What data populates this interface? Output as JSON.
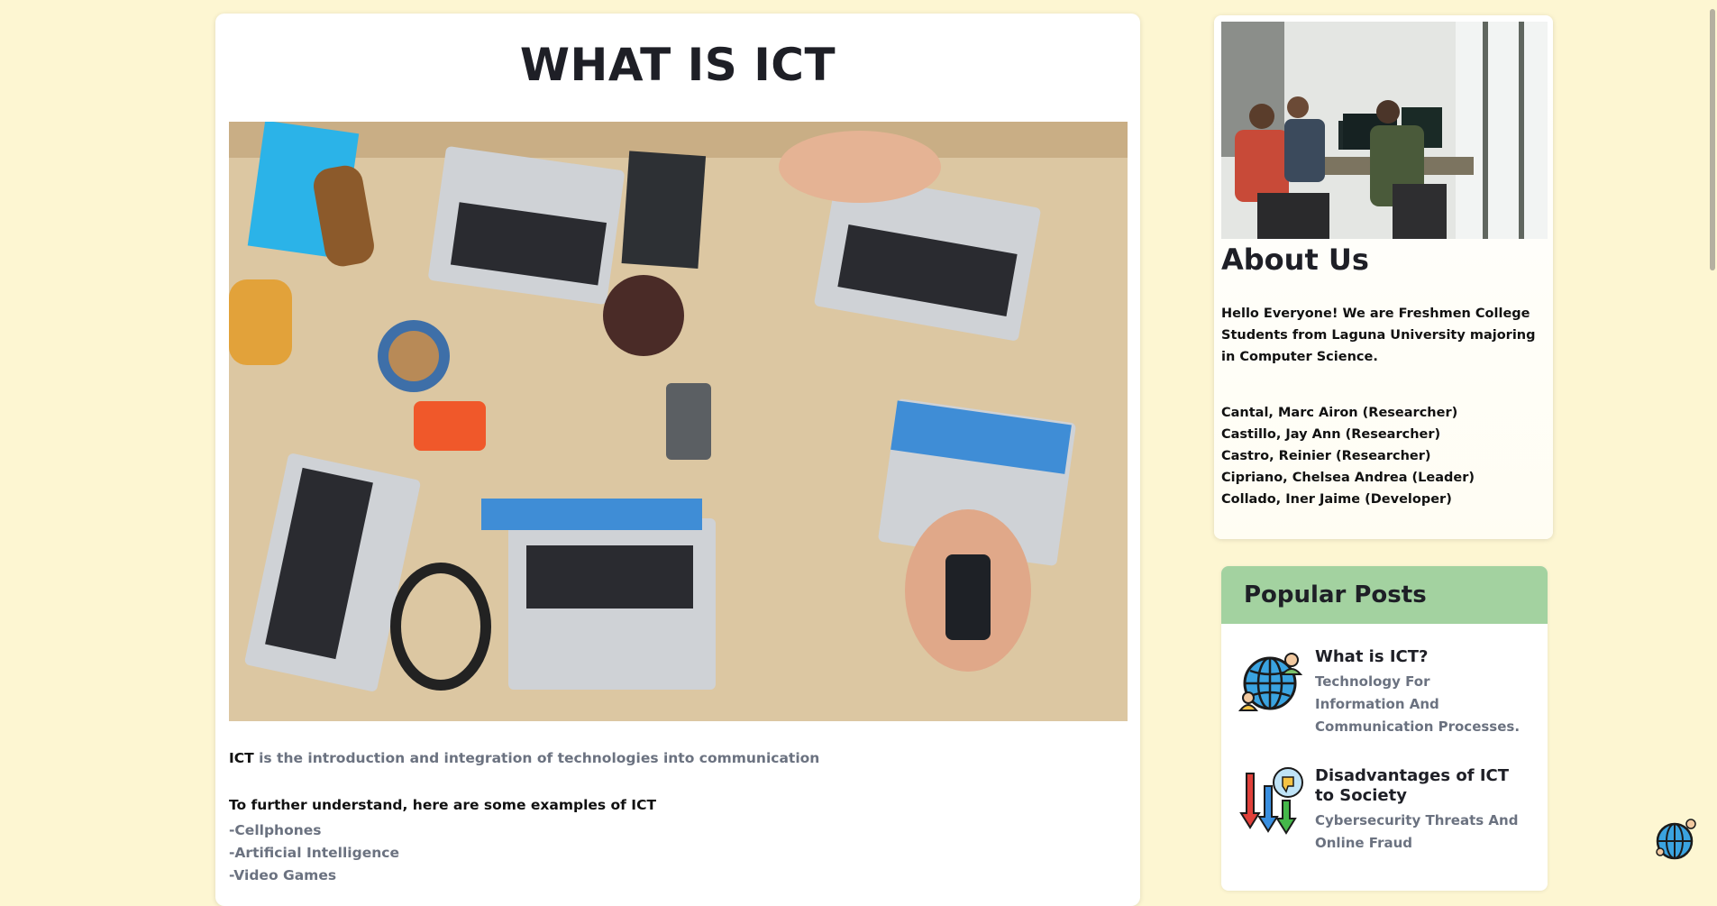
{
  "main": {
    "title": "WHAT IS ICT",
    "intro_term": "ICT",
    "intro_rest": " is the introduction and integration of technologies into communication",
    "examples_heading": "To further understand, here are some examples of ICT",
    "examples": [
      "-Cellphones",
      "-Artificial Intelligence",
      "-Video Games"
    ]
  },
  "about": {
    "title": "About Us",
    "description": "Hello Everyone! We are Freshmen College Students from Laguna University majoring in Computer Science.",
    "members": [
      "Cantal, Marc Airon (Researcher)",
      "Castillo, Jay Ann (Researcher)",
      "Castro, Reinier (Researcher)",
      "Cipriano, Chelsea Andrea (Leader)",
      "Collado, Iner Jaime (Developer)"
    ]
  },
  "popular": {
    "title": "Popular Posts",
    "posts": [
      {
        "title": "What is ICT?",
        "subtitle": "Technology For Information And Communication Processes.",
        "icon": "globe-people-icon"
      },
      {
        "title": "Disadvantages of ICT to Society",
        "subtitle": "Cybersecurity Threats And Online Fraud",
        "icon": "arrows-thumbsdown-icon"
      }
    ]
  },
  "colors": {
    "background": "#fdf6d2",
    "popular_header": "#a3d2a0",
    "muted_text": "#6b7280"
  }
}
